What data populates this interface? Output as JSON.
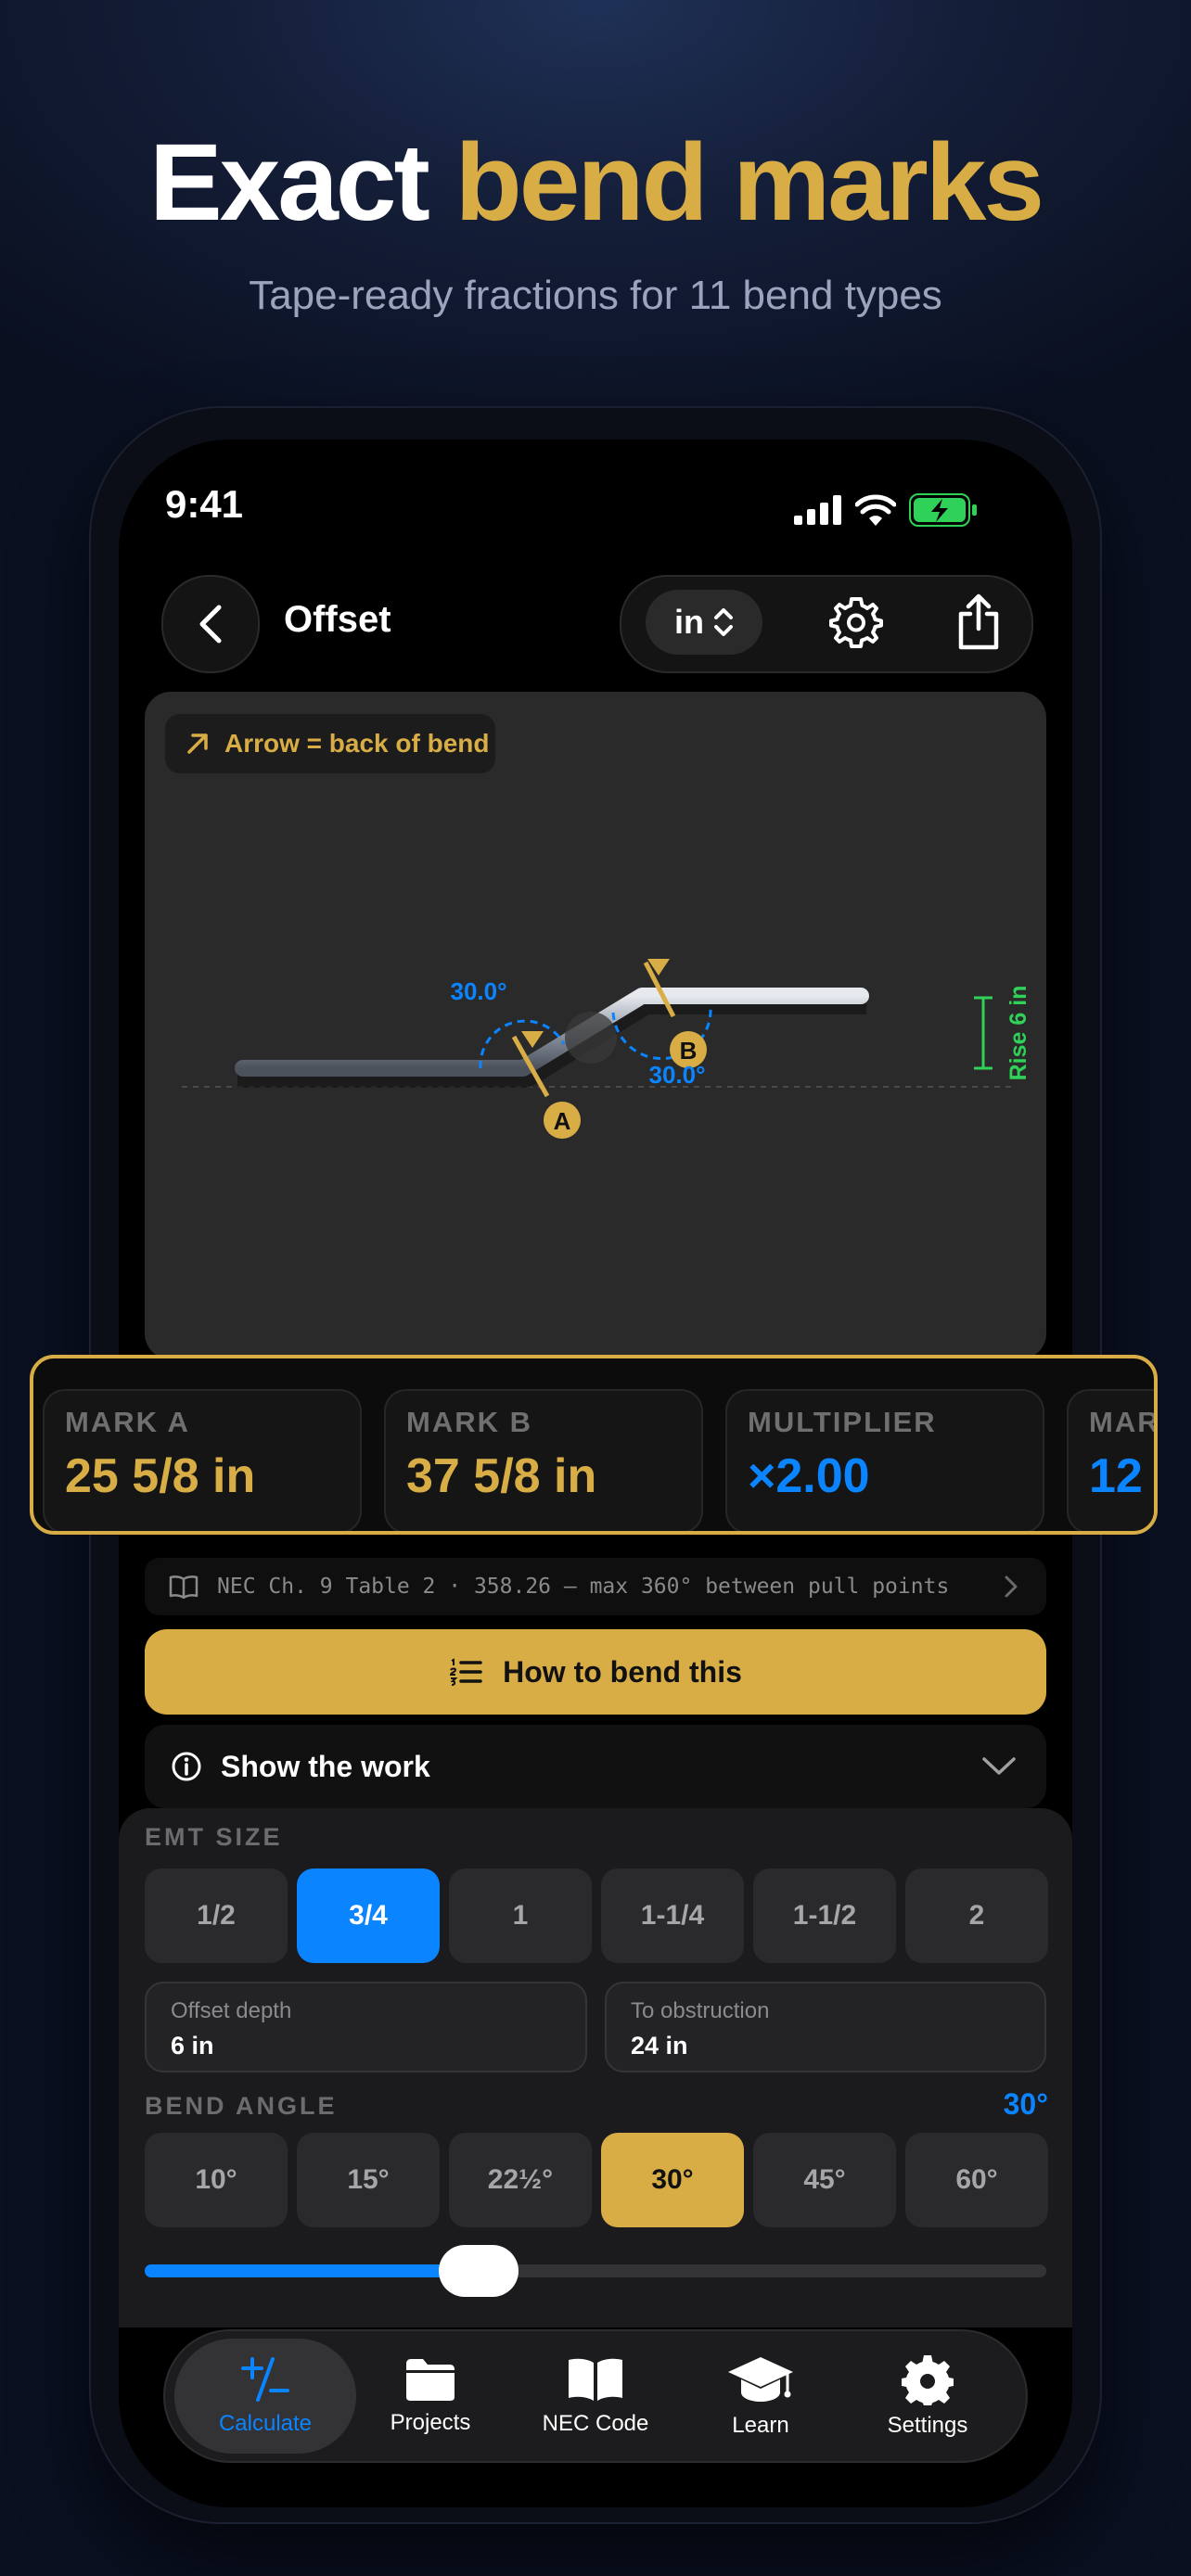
{
  "hero": {
    "title_white": "Exact",
    "title_accent": "bend marks",
    "subtitle": "Tape-ready fractions for 11 bend types"
  },
  "status": {
    "time": "9:41"
  },
  "nav": {
    "title": "Offset",
    "unit": "in"
  },
  "diagram": {
    "tag": "Arrow = back of bend",
    "angle_a": "30.0°",
    "angle_b": "30.0°",
    "mark_a": "A",
    "mark_b": "B",
    "rise": "Rise 6 in"
  },
  "results": [
    {
      "label": "MARK A",
      "value": "25 5/8 in",
      "color": "#d9ad46"
    },
    {
      "label": "MARK B",
      "value": "37 5/8 in",
      "color": "#d9ad46"
    },
    {
      "label": "MULTIPLIER",
      "value": "×2.00",
      "color": "#0a84ff"
    },
    {
      "label": "MAR",
      "value": "12",
      "color": "#0a84ff"
    }
  ],
  "nec": {
    "text": "NEC Ch. 9 Table 2 · 358.26 — max 360° between pull points"
  },
  "how_button": "How to bend this",
  "show_work": "Show the work",
  "emt": {
    "label": "EMT SIZE",
    "options": [
      "1/2",
      "3/4",
      "1",
      "1-1/4",
      "1-1/2",
      "2"
    ],
    "selected": "3/4"
  },
  "fields": [
    {
      "label": "Offset depth",
      "value": "6 in"
    },
    {
      "label": "To obstruction",
      "value": "24 in"
    }
  ],
  "bend_angle": {
    "label": "BEND ANGLE",
    "value": "30°",
    "options": [
      "10°",
      "15°",
      "22½°",
      "30°",
      "45°",
      "60°"
    ],
    "selected": "30°",
    "slider_fraction": 0.37
  },
  "tabs": [
    {
      "label": "Calculate",
      "icon": "plus-minus-icon",
      "active": true
    },
    {
      "label": "Projects",
      "icon": "folder-icon",
      "active": false
    },
    {
      "label": "NEC Code",
      "icon": "book-icon",
      "active": false
    },
    {
      "label": "Learn",
      "icon": "graduation-cap-icon",
      "active": false
    },
    {
      "label": "Settings",
      "icon": "gear-icon",
      "active": false
    }
  ],
  "colors": {
    "gold": "#d9ad46",
    "blue": "#0a84ff",
    "green": "#30d158"
  }
}
